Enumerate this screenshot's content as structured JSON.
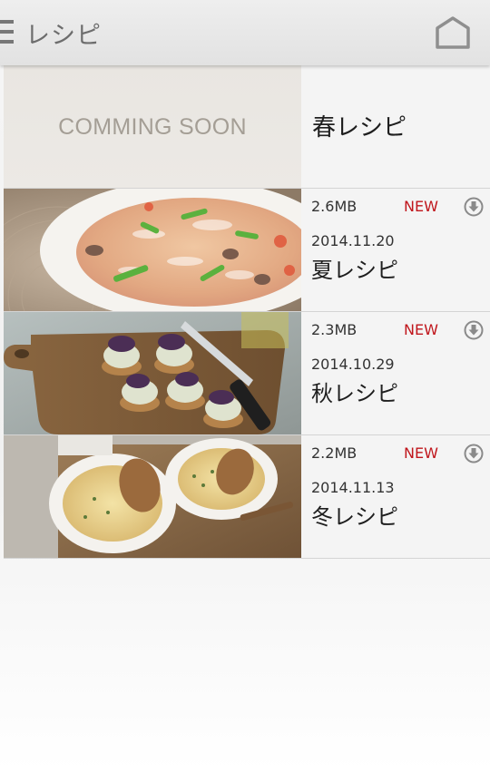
{
  "header": {
    "title": "レシピ",
    "menu_icon": "hamburger-menu-icon",
    "home_icon": "home-icon"
  },
  "recipes": [
    {
      "placeholder": "COMMING SOON",
      "title": "春レシピ"
    },
    {
      "size": "2.6MB",
      "badge": "NEW",
      "date": "2014.11.20",
      "title": "夏レシピ",
      "image": "soup-photo",
      "download_icon": "download-icon"
    },
    {
      "size": "2.3MB",
      "badge": "NEW",
      "date": "2014.10.29",
      "title": "秋レシピ",
      "image": "appetizer-board-photo",
      "download_icon": "download-icon"
    },
    {
      "size": "2.2MB",
      "badge": "NEW",
      "date": "2014.11.13",
      "title": "冬レシピ",
      "image": "gratin-photo",
      "download_icon": "download-icon"
    }
  ],
  "colors": {
    "new_badge": "#c0161c",
    "header_bg": "#e6e6e6",
    "title_text": "#6d6d6d"
  }
}
